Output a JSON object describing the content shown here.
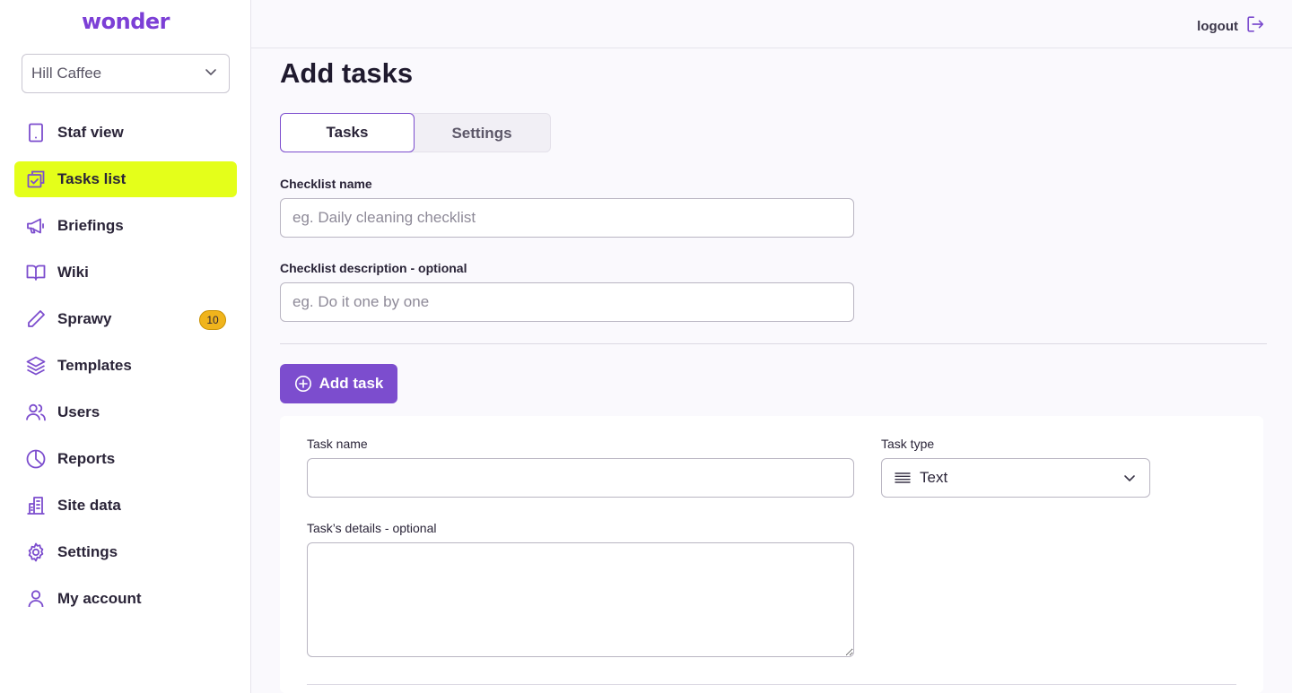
{
  "brand": {
    "logo": "wonder",
    "accent": "#7c4dce",
    "highlight": "#e4ff1a"
  },
  "sidebar": {
    "site_select": {
      "value": "Hill Caffee"
    },
    "items": [
      {
        "label": "Staf view",
        "icon": "tablet-icon",
        "active": false
      },
      {
        "label": "Tasks list",
        "icon": "tasks-checklist-icon",
        "active": true
      },
      {
        "label": "Briefings",
        "icon": "megaphone-icon",
        "active": false
      },
      {
        "label": "Wiki",
        "icon": "book-open-icon",
        "active": false
      },
      {
        "label": "Sprawy",
        "icon": "pencil-icon",
        "active": false,
        "badge": "10"
      },
      {
        "label": "Templates",
        "icon": "layers-icon",
        "active": false
      },
      {
        "label": "Users",
        "icon": "users-icon",
        "active": false
      },
      {
        "label": "Reports",
        "icon": "pie-chart-icon",
        "active": false
      },
      {
        "label": "Site data",
        "icon": "building-icon",
        "active": false
      },
      {
        "label": "Settings",
        "icon": "gear-icon",
        "active": false
      },
      {
        "label": "My account",
        "icon": "user-icon",
        "active": false
      }
    ]
  },
  "topbar": {
    "logout_label": "logout"
  },
  "main": {
    "title": "Add tasks",
    "tabs": [
      {
        "label": "Tasks",
        "active": true
      },
      {
        "label": "Settings",
        "active": false
      }
    ],
    "checklist_name": {
      "label": "Checklist name",
      "placeholder": "eg. Daily cleaning checklist",
      "value": ""
    },
    "checklist_description": {
      "label": "Checklist description - optional",
      "placeholder": "eg. Do it one by one",
      "value": ""
    },
    "add_task_label": "Add task",
    "task": {
      "name_label": "Task name",
      "name_value": "",
      "type_label": "Task type",
      "type_value": "Text",
      "details_label": "Task’s details - optional",
      "details_value": ""
    }
  }
}
